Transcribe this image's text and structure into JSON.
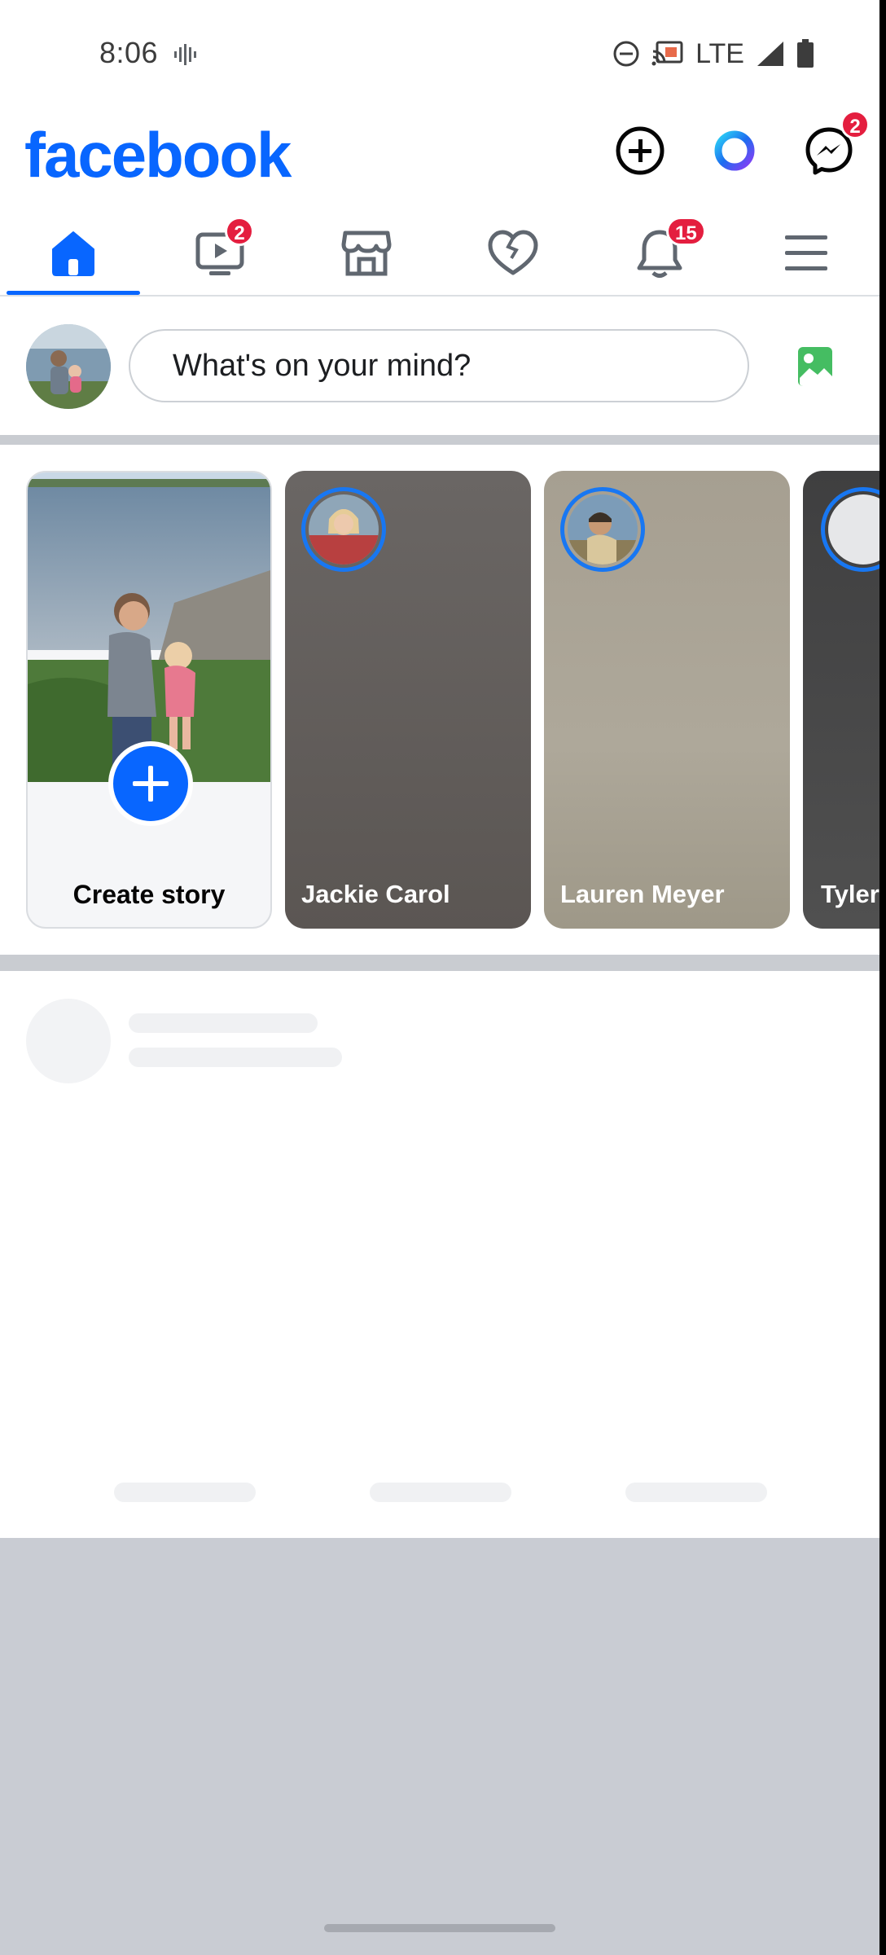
{
  "status_bar": {
    "time": "8:06",
    "network": "LTE",
    "icons": [
      "vibrate-icon",
      "dnd-icon",
      "cast-icon",
      "signal-icon",
      "battery-icon"
    ]
  },
  "header": {
    "logo": "facebook",
    "actions": [
      {
        "name": "create-icon"
      },
      {
        "name": "meta-ai-icon"
      },
      {
        "name": "messenger-icon",
        "badge": "2"
      }
    ]
  },
  "tabs": [
    {
      "name": "home-icon",
      "active": true
    },
    {
      "name": "video-icon",
      "badge": "2"
    },
    {
      "name": "marketplace-icon"
    },
    {
      "name": "dating-icon"
    },
    {
      "name": "notifications-icon",
      "badge": "15"
    },
    {
      "name": "menu-icon"
    }
  ],
  "composer": {
    "placeholder": "What's on your mind?"
  },
  "stories": {
    "create_label": "Create story",
    "items": [
      {
        "name": "Jackie Carol"
      },
      {
        "name": "Lauren Meyer"
      },
      {
        "name": "Tyler"
      }
    ]
  },
  "colors": {
    "brand": "#0866ff",
    "badge": "#e41e3f",
    "ring": "#1877f2"
  }
}
